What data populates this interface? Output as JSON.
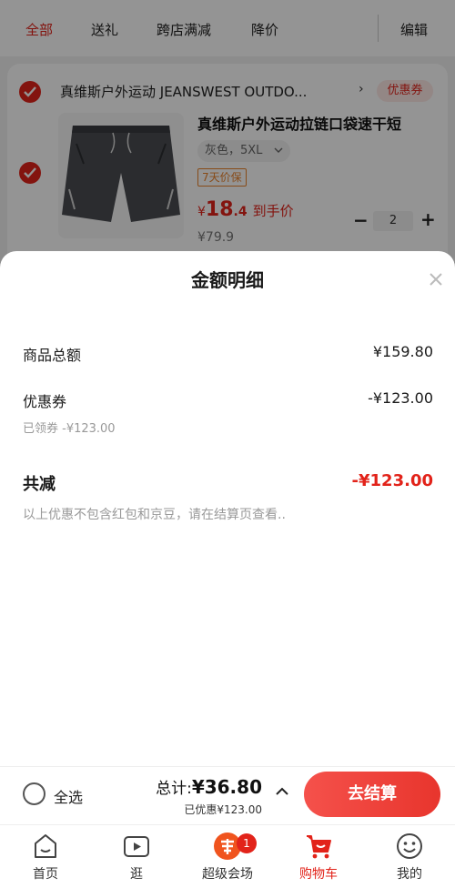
{
  "top_tabs": {
    "all": "全部",
    "gift": "送礼",
    "cross_store": "跨店满减",
    "price_drop": "降价",
    "edit": "编辑"
  },
  "shop": {
    "name": "真维斯户外运动 JEANSWEST OUTDO...",
    "arrow": "›",
    "coupon_label": "优惠券"
  },
  "product": {
    "title": "真维斯户外运动拉链口袋速干短",
    "spec": "灰色，5XL",
    "guarantee": "7天价保",
    "price_currency": "¥",
    "price_int": "18",
    "price_dec": ".4",
    "price_tag": "到手价",
    "original_price": "¥79.9",
    "quantity": "2"
  },
  "sheet": {
    "title": "金额明细",
    "goods_total_label": "商品总额",
    "goods_total_value": "¥159.80",
    "coupon_label": "优惠券",
    "coupon_value": "-¥123.00",
    "coupon_claimed": "已领券 -¥123.00",
    "total_reduce_label": "共减",
    "total_reduce_value": "-¥123.00",
    "note": "以上优惠不包含红包和京豆，请在结算页查看.."
  },
  "checkout": {
    "select_all": "全选",
    "total_prefix": "总计:",
    "total_amount": "¥36.80",
    "saved": "已优惠¥123.00",
    "button": "去结算"
  },
  "bottom_nav": {
    "items": [
      {
        "label": "首页",
        "icon": "home-icon"
      },
      {
        "label": "逛",
        "icon": "video-play-icon"
      },
      {
        "label": "超级会场",
        "icon": "super-venue-icon"
      },
      {
        "label": "购物车",
        "icon": "cart-icon"
      },
      {
        "label": "我的",
        "icon": "smiley-icon"
      }
    ],
    "badge": "1"
  },
  "colors": {
    "accent_red": "#e2231a",
    "guarantee_orange": "#e9812a",
    "muted_text": "#999999"
  }
}
